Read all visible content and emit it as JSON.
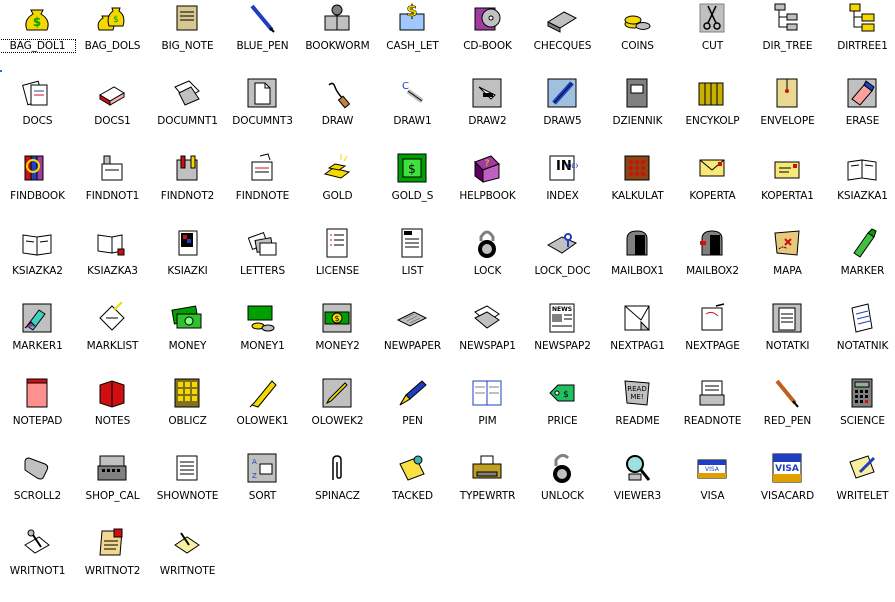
{
  "window": {
    "background": "#ffffff"
  },
  "selected_index": 0,
  "icons": [
    {
      "label": "BAG_DOL1",
      "icon": "money-bag-icon"
    },
    {
      "label": "BAG_DOLS",
      "icon": "money-bags-icon"
    },
    {
      "label": "BIG_NOTE",
      "icon": "scroll-notes-icon"
    },
    {
      "label": "BLUE_PEN",
      "icon": "blue-pen-icon"
    },
    {
      "label": "BOOKWORM",
      "icon": "bookworm-icon"
    },
    {
      "label": "CASH_LET",
      "icon": "cash-letter-icon"
    },
    {
      "label": "CD-BOOK",
      "icon": "cd-book-icon"
    },
    {
      "label": "CHECQUES",
      "icon": "checkbook-icon"
    },
    {
      "label": "COINS",
      "icon": "coins-icon"
    },
    {
      "label": "CUT",
      "icon": "scissors-icon"
    },
    {
      "label": "DIR_TREE",
      "icon": "directory-tree-icon"
    },
    {
      "label": "DIRTREE1",
      "icon": "folder-tree-icon"
    },
    {
      "label": "DOCS",
      "icon": "documents-icon"
    },
    {
      "label": "DOCS1",
      "icon": "document-stack-icon"
    },
    {
      "label": "DOCUMNT1",
      "icon": "torn-documents-icon"
    },
    {
      "label": "DOCUMNT3",
      "icon": "blank-document-icon"
    },
    {
      "label": "DRAW",
      "icon": "drawing-tool-icon"
    },
    {
      "label": "DRAW1",
      "icon": "drawing-brush-icon"
    },
    {
      "label": "DRAW2",
      "icon": "drawing-box-icon"
    },
    {
      "label": "DRAW5",
      "icon": "blue-pencil-box-icon"
    },
    {
      "label": "DZIENNIK",
      "icon": "notebook-icon"
    },
    {
      "label": "ENCYKOLP",
      "icon": "encyclopedia-icon"
    },
    {
      "label": "ENVELOPE",
      "icon": "envelope-icon"
    },
    {
      "label": "ERASE",
      "icon": "eraser-icon"
    },
    {
      "label": "FINDBOOK",
      "icon": "find-book-icon"
    },
    {
      "label": "FINDNOT1",
      "icon": "find-note-1-icon"
    },
    {
      "label": "FINDNOT2",
      "icon": "find-note-2-icon"
    },
    {
      "label": "FINDNOTE",
      "icon": "find-note-icon"
    },
    {
      "label": "GOLD",
      "icon": "gold-bars-icon"
    },
    {
      "label": "GOLD_S",
      "icon": "gold-square-icon"
    },
    {
      "label": "HELPBOOK",
      "icon": "help-book-icon"
    },
    {
      "label": "INDEX",
      "icon": "index-icon"
    },
    {
      "label": "KALKULAT",
      "icon": "abacus-icon"
    },
    {
      "label": "KOPERTA",
      "icon": "yellow-envelope-icon"
    },
    {
      "label": "KOPERTA1",
      "icon": "yellow-envelope-open-icon"
    },
    {
      "label": "KSIAZKA1",
      "icon": "open-book-icon"
    },
    {
      "label": "KSIAZKA2",
      "icon": "open-book-2-icon"
    },
    {
      "label": "KSIAZKA3",
      "icon": "open-book-3-icon"
    },
    {
      "label": "KSIAZKI",
      "icon": "books-icon"
    },
    {
      "label": "LETTERS",
      "icon": "letters-icon"
    },
    {
      "label": "LICENSE",
      "icon": "license-icon"
    },
    {
      "label": "LIST",
      "icon": "list-icon"
    },
    {
      "label": "LOCK",
      "icon": "padlock-icon"
    },
    {
      "label": "LOCK_DOC",
      "icon": "locked-document-icon"
    },
    {
      "label": "MAILBOX1",
      "icon": "mailbox-icon"
    },
    {
      "label": "MAILBOX2",
      "icon": "mailbox-flag-icon"
    },
    {
      "label": "MAPA",
      "icon": "treasure-map-icon"
    },
    {
      "label": "MARKER",
      "icon": "green-marker-icon"
    },
    {
      "label": "MARKER1",
      "icon": "marker-box-icon"
    },
    {
      "label": "MARKLIST",
      "icon": "marked-list-icon"
    },
    {
      "label": "MONEY",
      "icon": "banknotes-icon"
    },
    {
      "label": "MONEY1",
      "icon": "banknotes-coins-icon"
    },
    {
      "label": "MONEY2",
      "icon": "dollar-bill-icon"
    },
    {
      "label": "NEWPAPER",
      "icon": "newspaper-icon"
    },
    {
      "label": "NEWSPAP1",
      "icon": "newspaper-1-icon"
    },
    {
      "label": "NEWSPAP2",
      "icon": "newspaper-2-icon"
    },
    {
      "label": "NEXTPAG1",
      "icon": "next-page-1-icon"
    },
    {
      "label": "NEXTPAGE",
      "icon": "next-page-icon"
    },
    {
      "label": "NOTATKI",
      "icon": "notes-pad-icon"
    },
    {
      "label": "NOTATNIK",
      "icon": "notebook-pad-icon"
    },
    {
      "label": "NOTEPAD",
      "icon": "notepad-icon"
    },
    {
      "label": "NOTES",
      "icon": "red-notebook-icon"
    },
    {
      "label": "OBLICZ",
      "icon": "keypad-icon"
    },
    {
      "label": "OLOWEK1",
      "icon": "pencil-icon"
    },
    {
      "label": "OLOWEK2",
      "icon": "pencil-box-icon"
    },
    {
      "label": "PEN",
      "icon": "fountain-pen-icon"
    },
    {
      "label": "PIM",
      "icon": "organizer-icon"
    },
    {
      "label": "PRICE",
      "icon": "price-tag-icon"
    },
    {
      "label": "README",
      "icon": "readme-icon"
    },
    {
      "label": "READNOTE",
      "icon": "read-note-icon"
    },
    {
      "label": "RED_PEN",
      "icon": "red-pen-icon"
    },
    {
      "label": "SCIENCE",
      "icon": "calculator-icon"
    },
    {
      "label": "SCROLL2",
      "icon": "scroll-icon"
    },
    {
      "label": "SHOP_CAL",
      "icon": "cash-register-icon"
    },
    {
      "label": "SHOWNOTE",
      "icon": "show-note-icon"
    },
    {
      "label": "SORT",
      "icon": "sort-icon"
    },
    {
      "label": "SPINACZ",
      "icon": "paperclip-icon"
    },
    {
      "label": "TACKED",
      "icon": "pinned-note-icon"
    },
    {
      "label": "TYPEWRTR",
      "icon": "typewriter-icon"
    },
    {
      "label": "UNLOCK",
      "icon": "unlocked-padlock-icon"
    },
    {
      "label": "VIEWER3",
      "icon": "magnifier-icon"
    },
    {
      "label": "VISA",
      "icon": "visa-card-icon"
    },
    {
      "label": "VISACARD",
      "icon": "visa-card-large-icon"
    },
    {
      "label": "WRITELET",
      "icon": "write-letter-icon"
    },
    {
      "label": "WRITNOT1",
      "icon": "write-note-1-icon"
    },
    {
      "label": "WRITNOT2",
      "icon": "write-note-2-icon"
    },
    {
      "label": "WRITNOTE",
      "icon": "write-note-icon"
    }
  ]
}
